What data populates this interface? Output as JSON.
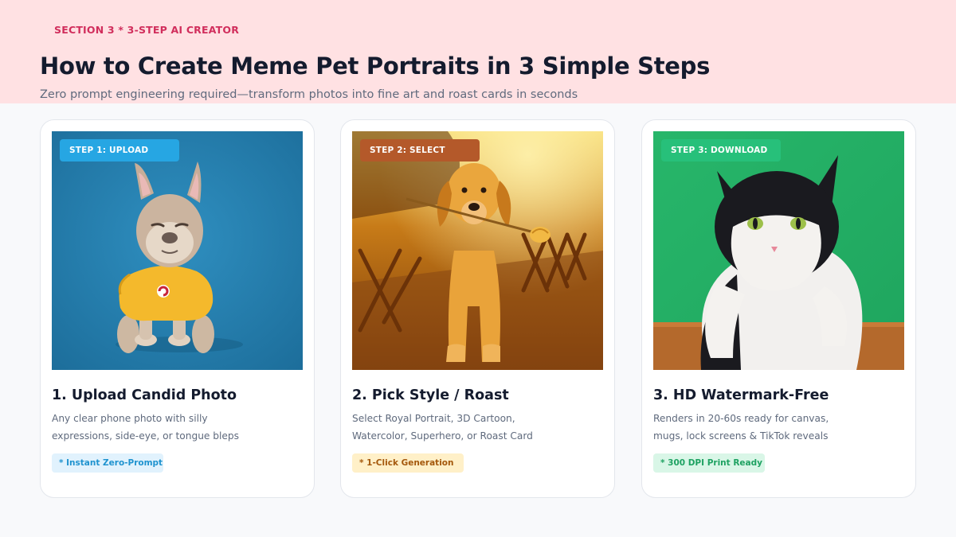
{
  "header": {
    "eyebrow": "SECTION 3 * 3-STEP AI CREATOR",
    "title": "How to Create Meme Pet Portraits in 3 Simple Steps",
    "subtitle": "Zero prompt engineering required—transform photos into fine art and roast cards in seconds"
  },
  "cards": [
    {
      "step_label": "STEP 1: UPLOAD",
      "title": "1. Upload Candid Photo",
      "desc_lines": [
        "Any clear phone photo with silly",
        "expressions, side-eye, or tongue bleps"
      ],
      "tag": "* Instant Zero-Prompt",
      "photo": "french-bulldog-photo",
      "accent": "#26a6e3"
    },
    {
      "step_label": "STEP 2: SELECT",
      "title": "2. Pick Style / Roast",
      "desc_lines": [
        "Select Royal Portrait, 3D Cartoon,",
        "Watercolor, Superhero, or Roast Card"
      ],
      "tag": "* 1-Click Generation",
      "photo": "golden-retriever-photo",
      "accent": "#b4592a"
    },
    {
      "step_label": "STEP 3: DOWNLOAD",
      "title": "3. HD Watermark-Free",
      "desc_lines": [
        "Renders in 20-60s ready for canvas,",
        "mugs, lock screens & TikTok reveals"
      ],
      "tag": "* 300 DPI Print Ready",
      "photo": "tuxedo-cat-photo",
      "accent": "#27c07a"
    }
  ],
  "colors": {
    "hero_band": "#ffe1e3",
    "eyebrow": "#d12e5c",
    "page_bg": "#f8f9fb"
  }
}
